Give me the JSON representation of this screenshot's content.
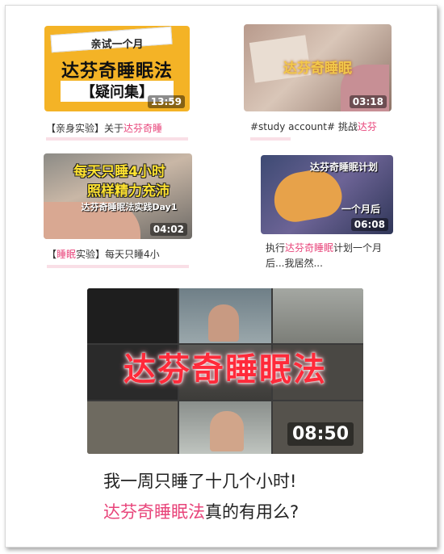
{
  "cards": [
    {
      "thumb_lines": [
        "亲试一个月",
        "达芬奇睡眠法",
        "【疑问集】"
      ],
      "duration": "13:59",
      "caption_pre": "【亲身实验】关于",
      "caption_hl": "达芬奇睡",
      "caption_rest": ""
    },
    {
      "thumb_lines": [
        "达芬奇睡眠"
      ],
      "duration": "03:18",
      "caption_pre": "#study account# 挑战",
      "caption_hl": "达芬",
      "caption_rest": ""
    },
    {
      "thumb_lines": [
        "每天只睡4小时",
        "照样精力充沛",
        "达芬奇睡眠法实践Day1"
      ],
      "duration": "04:02",
      "caption_pre": "【",
      "caption_hl": "睡眠",
      "caption_rest": "实验】每天只睡4小"
    },
    {
      "thumb_lines": [
        "达芬奇睡眠计划",
        "一个月后"
      ],
      "duration": "06:08",
      "caption_line1_pre": "执行",
      "caption_line1_hl": "达芬奇睡眠",
      "caption_line1_rest": "计划一个月",
      "caption_line2": "后...我居然..."
    }
  ],
  "featured": {
    "overlay_title": "达芬奇睡眠法",
    "duration": "08:50",
    "line1": "我一周只睡了十几个小时!",
    "line2_hl": "达芬奇睡眠法",
    "line2_rest": "真的有用么?"
  },
  "colors": {
    "highlight": "#e8447a",
    "thumb1_bg": "#f4b326",
    "overlay_red": "#ff2a3a"
  }
}
